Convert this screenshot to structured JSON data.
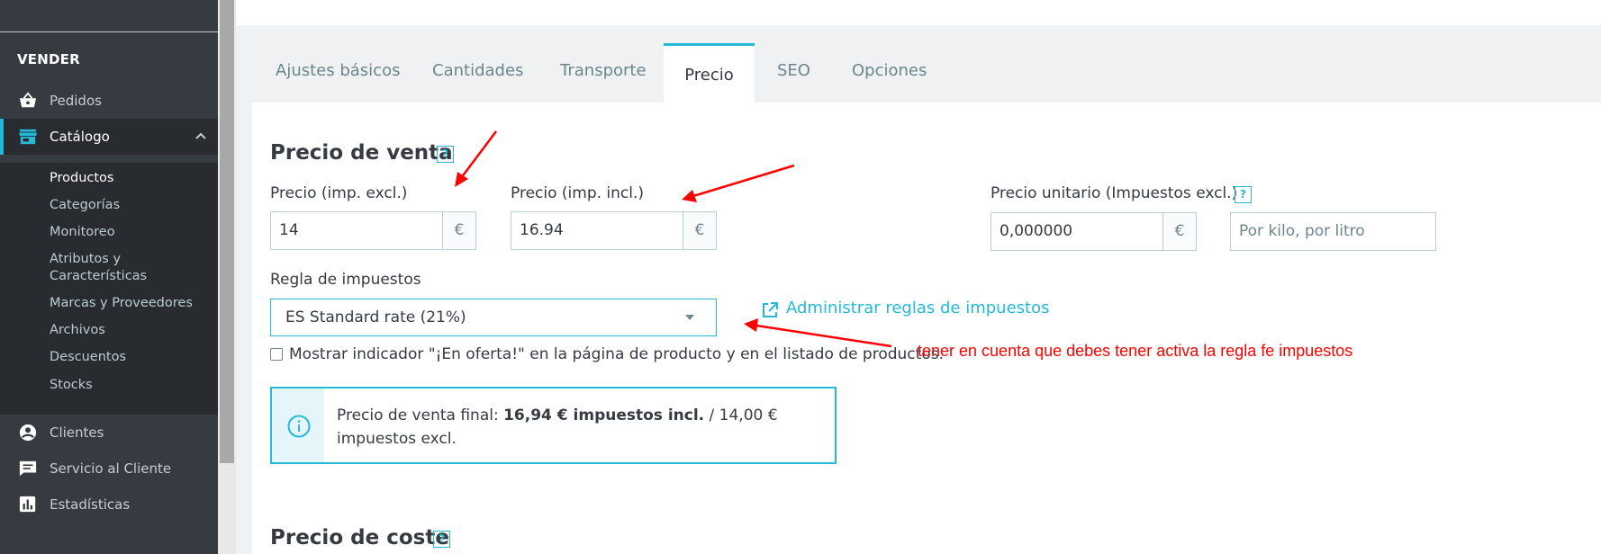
{
  "sidebar": {
    "section_title": "VENDER",
    "items": [
      {
        "label": "Pedidos",
        "icon": "basket-icon"
      },
      {
        "label": "Catálogo",
        "icon": "store-icon"
      },
      {
        "label": "Clientes",
        "icon": "user-circle-icon"
      },
      {
        "label": "Servicio al Cliente",
        "icon": "chat-icon"
      },
      {
        "label": "Estadísticas",
        "icon": "bar-chart-icon"
      }
    ],
    "submenu": [
      "Productos",
      "Categorías",
      "Monitoreo",
      "Atributos y Características",
      "Marcas y Proveedores",
      "Archivos",
      "Descuentos",
      "Stocks"
    ],
    "submenu_attr_line1": "Atributos y",
    "submenu_attr_line2": "Características"
  },
  "tabs": [
    "Ajustes básicos",
    "Cantidades",
    "Transporte",
    "Precio",
    "SEO",
    "Opciones"
  ],
  "active_tab": "Precio",
  "pricing": {
    "section_title": "Precio de venta",
    "help_glyph": "?",
    "price_excl_label": "Precio (imp. excl.)",
    "price_excl_value": "14",
    "price_incl_label": "Precio (imp. incl.)",
    "price_incl_value": "16.94",
    "currency": "€",
    "unit_price_label": "Precio unitario (Impuestos excl.)",
    "unit_price_value": "0,000000",
    "unit_placeholder": "Por kilo, por litro",
    "tax_rule_label": "Regla de impuestos",
    "tax_rule_value": "ES Standard rate (21%)",
    "manage_tax_link": "Administrar reglas de impuestos",
    "on_sale_label": "Mostrar indicador \"¡En oferta!\" en la página de producto y en el listado de productos.",
    "final_price_prefix": "Precio de venta final: ",
    "final_price_bold": "16,94 € impuestos incl.",
    "final_price_suffix": " / 14,00 € impuestos excl.",
    "cost_section_title": "Precio de coste"
  },
  "annotation": {
    "note": "tener en cuenta que debes tener activa la regla fe impuestos",
    "arrow_color": "#ff0000"
  },
  "colors": {
    "accent": "#25b9d7",
    "sidebar_bg": "#363a41",
    "annotation": "#ff0000"
  }
}
